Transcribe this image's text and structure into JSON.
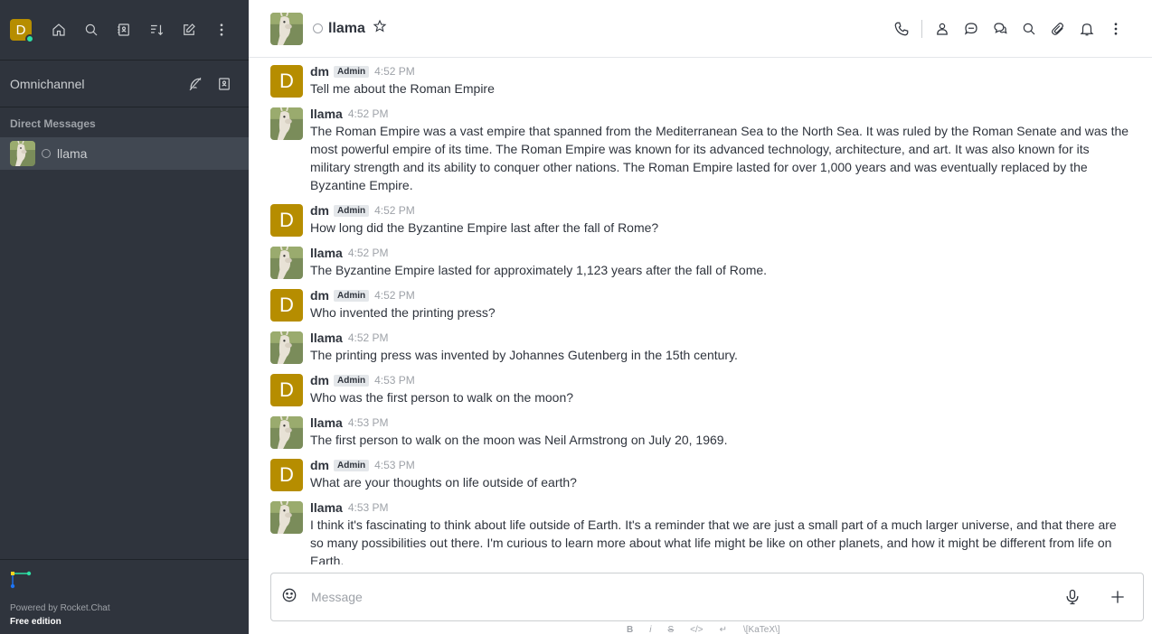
{
  "user": {
    "initial": "D",
    "status_color": "#2de0a5",
    "avatar_color": "#b68d00"
  },
  "sidebar": {
    "top_icons": [
      "home-icon",
      "search-icon",
      "directory-icon",
      "sort-icon",
      "create-new-icon",
      "kebab-icon"
    ],
    "omnichannel": {
      "label": "Omnichannel"
    },
    "section_title": "Direct Messages",
    "direct_messages": [
      {
        "name": "llama"
      }
    ],
    "footer": {
      "powered": "Powered by Rocket.Chat",
      "edition": "Free edition"
    }
  },
  "room": {
    "name": "llama",
    "actions": [
      "call-icon",
      "user-info-icon",
      "discussion-icon",
      "threads-icon",
      "search-icon",
      "attachment-icon",
      "notification-bell-icon",
      "kebab-icon"
    ]
  },
  "messages": [
    {
      "user": "dm",
      "badge": "Admin",
      "time": "4:52 PM",
      "text": "Tell me about the Roman Empire"
    },
    {
      "user": "llama",
      "badge": "",
      "time": "4:52 PM",
      "text": "The Roman Empire was a vast empire that spanned from the Mediterranean Sea to the North Sea. It was ruled by the Roman Senate and was the most powerful empire of its time. The Roman Empire was known for its advanced technology, architecture, and art. It was also known for its military strength and its ability to conquer other nations. The Roman Empire lasted for over 1,000 years and was eventually replaced by the Byzantine Empire."
    },
    {
      "user": "dm",
      "badge": "Admin",
      "time": "4:52 PM",
      "text": "How long did the Byzantine Empire last after the fall of Rome?"
    },
    {
      "user": "llama",
      "badge": "",
      "time": "4:52 PM",
      "text": "The Byzantine Empire lasted for approximately 1,123 years after the fall of Rome."
    },
    {
      "user": "dm",
      "badge": "Admin",
      "time": "4:52 PM",
      "text": "Who invented the printing press?"
    },
    {
      "user": "llama",
      "badge": "",
      "time": "4:52 PM",
      "text": "The printing press was invented by Johannes Gutenberg in the 15th century."
    },
    {
      "user": "dm",
      "badge": "Admin",
      "time": "4:53 PM",
      "text": "Who was the first person to walk on the moon?"
    },
    {
      "user": "llama",
      "badge": "",
      "time": "4:53 PM",
      "text": "The first person to walk on the moon was Neil Armstrong on July 20, 1969."
    },
    {
      "user": "dm",
      "badge": "Admin",
      "time": "4:53 PM",
      "text": "What are your thoughts on life outside of earth?"
    },
    {
      "user": "llama",
      "badge": "",
      "time": "4:53 PM",
      "text": "I think it's fascinating to think about life outside of Earth. It's a reminder that we are just a small part of a much larger universe, and that there are so many possibilities out there. I'm curious to learn more about what life might be like on other planets, and how it might be different from life on Earth."
    }
  ],
  "composer": {
    "placeholder": "Message",
    "format_labels": [
      "B",
      "i",
      "S",
      "</>",
      "↵",
      "\\[KaTeX\\]"
    ]
  }
}
